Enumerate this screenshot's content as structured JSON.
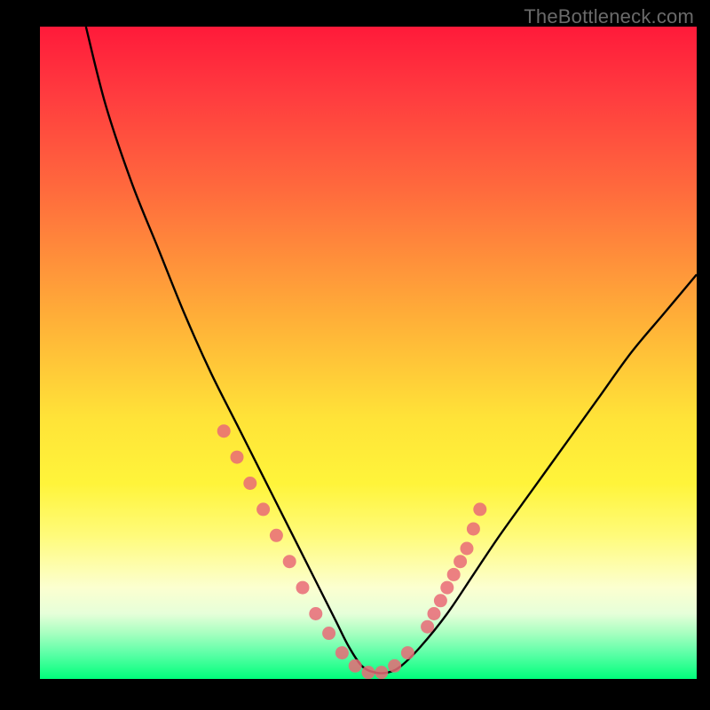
{
  "watermark": "TheBottleneck.com",
  "chart_data": {
    "type": "line",
    "title": "",
    "xlabel": "",
    "ylabel": "",
    "xlim": [
      0,
      100
    ],
    "ylim": [
      0,
      100
    ],
    "series": [
      {
        "name": "bottleneck-curve",
        "x": [
          7,
          10,
          14,
          18,
          22,
          26,
          30,
          34,
          38,
          42,
          45,
          47,
          49,
          51,
          53,
          55,
          58,
          62,
          66,
          70,
          75,
          80,
          85,
          90,
          95,
          100
        ],
        "y": [
          100,
          88,
          76,
          66,
          56,
          47,
          39,
          31,
          23,
          15,
          9,
          5,
          2,
          1,
          1,
          2,
          5,
          10,
          16,
          22,
          29,
          36,
          43,
          50,
          56,
          62
        ]
      }
    ],
    "markers": {
      "name": "highlight-points",
      "color": "#e96a77",
      "x": [
        28,
        30,
        32,
        34,
        36,
        38,
        40,
        42,
        44,
        46,
        48,
        50,
        52,
        54,
        56,
        59,
        60,
        61,
        62,
        63,
        64,
        65,
        66,
        67
      ],
      "y": [
        38,
        34,
        30,
        26,
        22,
        18,
        14,
        10,
        7,
        4,
        2,
        1,
        1,
        2,
        4,
        8,
        10,
        12,
        14,
        16,
        18,
        20,
        23,
        26
      ]
    },
    "gradient_meaning": "top=red (high bottleneck), bottom=green (no bottleneck)"
  }
}
